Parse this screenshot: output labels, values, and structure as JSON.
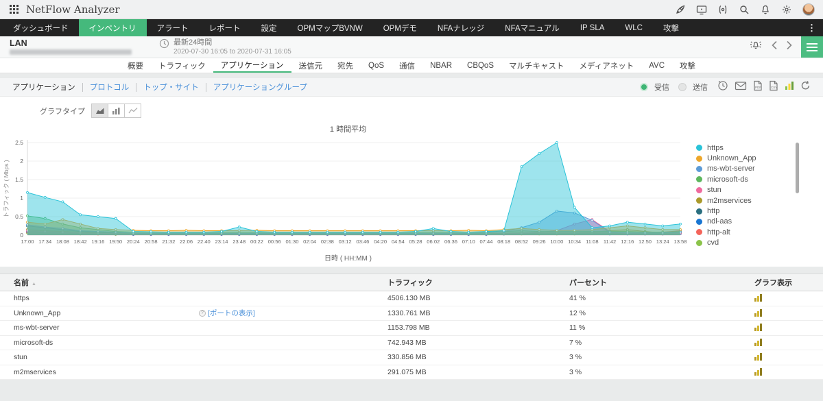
{
  "topbar": {
    "title": "NetFlow Analyzer"
  },
  "navbar": {
    "items": [
      "ダッシュボード",
      "インベントリ",
      "アラート",
      "レポート",
      "設定",
      "OPMマップBVNW",
      "OPMデモ",
      "NFAナレッジ",
      "NFAマニュアル",
      "IP SLA",
      "WLC",
      "攻撃"
    ],
    "active_index": 1,
    "more_glyph": "⋮"
  },
  "lanbar": {
    "title": "LAN",
    "period_label": "最新24時間",
    "period_range": "2020-07-30 16:05 to 2020-07-31 16:05"
  },
  "tabs": {
    "items": [
      "概要",
      "トラフィック",
      "アプリケーション",
      "送信元",
      "宛先",
      "QoS",
      "通信",
      "NBAR",
      "CBQoS",
      "マルチキャスト",
      "メディアネット",
      "AVC",
      "攻撃"
    ],
    "active": "アプリケーション"
  },
  "subnav": {
    "items": [
      "アプリケーション",
      "プロトコル",
      "トップ・サイト",
      "アプリケーショングループ"
    ],
    "active_index": 0,
    "receive_label": "受信",
    "send_label": "送信"
  },
  "graph_type_label": "グラフタイプ",
  "accent_color": "#45b97c",
  "chart_data": {
    "type": "area",
    "title": "1 時間平均",
    "xlabel": "日時 ( HH:MM )",
    "ylabel": "トラフィック ( Mbps )",
    "ylim": [
      0,
      2.5
    ],
    "yticks": [
      0,
      0.5,
      1,
      1.5,
      2,
      2.5
    ],
    "grid": true,
    "legend_position": "right",
    "categories": [
      "17:00",
      "17:34",
      "18:08",
      "18:42",
      "19:16",
      "19:50",
      "20:24",
      "20:58",
      "21:32",
      "22:06",
      "22:40",
      "23:14",
      "23:48",
      "00:22",
      "00:56",
      "01:30",
      "02:04",
      "02:38",
      "03:12",
      "03:46",
      "04:20",
      "04:54",
      "05:28",
      "06:02",
      "06:36",
      "07:10",
      "07:44",
      "08:18",
      "08:52",
      "09:26",
      "10:00",
      "10:34",
      "11:08",
      "11:42",
      "12:16",
      "12:50",
      "13:24",
      "13:58"
    ],
    "series": [
      {
        "name": "https",
        "color": "#29c3d8",
        "values": [
          1.15,
          1.02,
          0.9,
          0.55,
          0.5,
          0.45,
          0.1,
          0.09,
          0.08,
          0.08,
          0.08,
          0.1,
          0.22,
          0.1,
          0.08,
          0.08,
          0.08,
          0.08,
          0.08,
          0.08,
          0.08,
          0.08,
          0.1,
          0.18,
          0.1,
          0.08,
          0.1,
          0.12,
          1.85,
          2.2,
          2.5,
          0.75,
          0.2,
          0.25,
          0.35,
          0.3,
          0.25,
          0.3
        ]
      },
      {
        "name": "Unknown_App",
        "color": "#eda72b",
        "values": [
          0.35,
          0.3,
          0.42,
          0.3,
          0.18,
          0.15,
          0.13,
          0.12,
          0.12,
          0.13,
          0.12,
          0.12,
          0.12,
          0.13,
          0.12,
          0.12,
          0.12,
          0.12,
          0.12,
          0.12,
          0.12,
          0.12,
          0.12,
          0.12,
          0.12,
          0.13,
          0.12,
          0.15,
          0.18,
          0.15,
          0.13,
          0.13,
          0.15,
          0.2,
          0.25,
          0.2,
          0.15,
          0.15
        ]
      },
      {
        "name": "ms-wbt-server",
        "color": "#5c9bd6",
        "values": [
          0.28,
          0.22,
          0.18,
          0.12,
          0.1,
          0.08,
          0.05,
          0.05,
          0.05,
          0.05,
          0.05,
          0.05,
          0.05,
          0.05,
          0.05,
          0.05,
          0.05,
          0.05,
          0.05,
          0.05,
          0.05,
          0.05,
          0.05,
          0.05,
          0.05,
          0.05,
          0.06,
          0.1,
          0.2,
          0.35,
          0.65,
          0.6,
          0.4,
          0.08,
          0.06,
          0.06,
          0.06,
          0.08
        ]
      },
      {
        "name": "microsoft-ds",
        "color": "#5db75d",
        "values": [
          0.52,
          0.45,
          0.3,
          0.2,
          0.15,
          0.1,
          0.08,
          0.08,
          0.08,
          0.08,
          0.08,
          0.08,
          0.08,
          0.08,
          0.08,
          0.08,
          0.08,
          0.08,
          0.08,
          0.08,
          0.08,
          0.08,
          0.08,
          0.08,
          0.08,
          0.08,
          0.08,
          0.1,
          0.12,
          0.1,
          0.1,
          0.1,
          0.1,
          0.1,
          0.1,
          0.08,
          0.08,
          0.1
        ]
      },
      {
        "name": "stun",
        "color": "#ef6a9e",
        "values": [
          0.12,
          0.1,
          0.08,
          0.06,
          0.05,
          0.04,
          0.03,
          0.03,
          0.03,
          0.03,
          0.03,
          0.03,
          0.03,
          0.03,
          0.03,
          0.03,
          0.03,
          0.03,
          0.03,
          0.03,
          0.03,
          0.03,
          0.03,
          0.03,
          0.03,
          0.03,
          0.03,
          0.04,
          0.05,
          0.08,
          0.12,
          0.3,
          0.42,
          0.1,
          0.04,
          0.03,
          0.03,
          0.05
        ]
      },
      {
        "name": "m2mservices",
        "color": "#ab9a2b",
        "values": [
          0.15,
          0.12,
          0.1,
          0.08,
          0.06,
          0.05,
          0.04,
          0.04,
          0.04,
          0.04,
          0.04,
          0.04,
          0.04,
          0.04,
          0.04,
          0.04,
          0.04,
          0.04,
          0.04,
          0.04,
          0.04,
          0.04,
          0.04,
          0.04,
          0.04,
          0.04,
          0.04,
          0.05,
          0.06,
          0.06,
          0.06,
          0.06,
          0.08,
          0.12,
          0.15,
          0.1,
          0.06,
          0.06
        ]
      },
      {
        "name": "http",
        "color": "#2a6f7f",
        "values": [
          0.25,
          0.2,
          0.15,
          0.1,
          0.08,
          0.06,
          0.04,
          0.04,
          0.04,
          0.04,
          0.04,
          0.04,
          0.04,
          0.04,
          0.04,
          0.04,
          0.04,
          0.04,
          0.04,
          0.04,
          0.04,
          0.04,
          0.04,
          0.04,
          0.04,
          0.04,
          0.04,
          0.04,
          0.05,
          0.05,
          0.05,
          0.05,
          0.05,
          0.05,
          0.05,
          0.05,
          0.05,
          0.06
        ]
      },
      {
        "name": "ndl-aas",
        "color": "#1976d2",
        "values": [
          0.1,
          0.08,
          0.06,
          0.05,
          0.04,
          0.03,
          0.02,
          0.02,
          0.02,
          0.02,
          0.02,
          0.02,
          0.02,
          0.02,
          0.02,
          0.02,
          0.02,
          0.02,
          0.02,
          0.02,
          0.02,
          0.02,
          0.02,
          0.02,
          0.02,
          0.02,
          0.02,
          0.03,
          0.04,
          0.04,
          0.04,
          0.04,
          0.04,
          0.03,
          0.03,
          0.03,
          0.03,
          0.04
        ]
      },
      {
        "name": "http-alt",
        "color": "#f4645a",
        "values": [
          0.08,
          0.06,
          0.05,
          0.04,
          0.03,
          0.03,
          0.02,
          0.02,
          0.02,
          0.02,
          0.02,
          0.02,
          0.02,
          0.02,
          0.02,
          0.02,
          0.02,
          0.02,
          0.02,
          0.02,
          0.02,
          0.02,
          0.02,
          0.02,
          0.02,
          0.02,
          0.02,
          0.03,
          0.04,
          0.05,
          0.05,
          0.05,
          0.06,
          0.05,
          0.05,
          0.06,
          0.08,
          0.12
        ]
      },
      {
        "name": "cvd",
        "color": "#8bc34a",
        "values": [
          0.06,
          0.05,
          0.04,
          0.03,
          0.03,
          0.02,
          0.02,
          0.02,
          0.02,
          0.02,
          0.02,
          0.02,
          0.02,
          0.02,
          0.02,
          0.02,
          0.02,
          0.02,
          0.02,
          0.02,
          0.02,
          0.02,
          0.02,
          0.02,
          0.02,
          0.02,
          0.02,
          0.03,
          0.03,
          0.03,
          0.03,
          0.03,
          0.04,
          0.04,
          0.04,
          0.03,
          0.03,
          0.04
        ]
      }
    ]
  },
  "table": {
    "columns": [
      "名前",
      "トラフィック",
      "パーセント",
      "グラフ表示"
    ],
    "port_link_label": "[ポートの表示]",
    "rows": [
      {
        "name": "https",
        "traffic": "4506.130 MB",
        "percent": "41 %",
        "has_port_link": false
      },
      {
        "name": "Unknown_App",
        "traffic": "1330.761 MB",
        "percent": "12 %",
        "has_port_link": true
      },
      {
        "name": "ms-wbt-server",
        "traffic": "1153.798 MB",
        "percent": "11 %",
        "has_port_link": false
      },
      {
        "name": "microsoft-ds",
        "traffic": "742.943 MB",
        "percent": "7 %",
        "has_port_link": false
      },
      {
        "name": "stun",
        "traffic": "330.856 MB",
        "percent": "3 %",
        "has_port_link": false
      },
      {
        "name": "m2mservices",
        "traffic": "291.075 MB",
        "percent": "3 %",
        "has_port_link": false
      }
    ]
  }
}
